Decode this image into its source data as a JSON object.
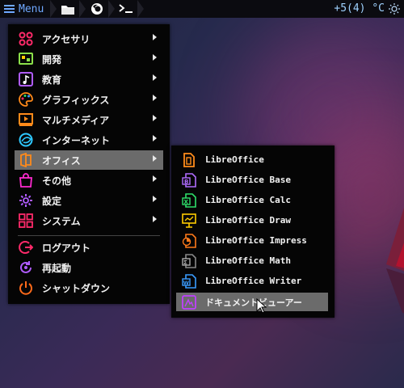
{
  "panel": {
    "menu_label": "Menu",
    "temperature": "+5(4) °C",
    "launchers": [
      "folder-icon",
      "firefox-icon",
      "terminal-icon"
    ]
  },
  "main_menu": {
    "items": [
      {
        "label": "アクセサリ",
        "icon": "accessories-icon",
        "submenu": true
      },
      {
        "label": "開発",
        "icon": "development-icon",
        "submenu": true
      },
      {
        "label": "教育",
        "icon": "education-icon",
        "submenu": true
      },
      {
        "label": "グラフィックス",
        "icon": "graphics-icon",
        "submenu": true
      },
      {
        "label": "マルチメディア",
        "icon": "multimedia-icon",
        "submenu": true
      },
      {
        "label": "インターネット",
        "icon": "internet-icon",
        "submenu": true
      },
      {
        "label": "オフィス",
        "icon": "office-icon",
        "submenu": true,
        "active": true
      },
      {
        "label": "その他",
        "icon": "other-icon",
        "submenu": true
      },
      {
        "label": "設定",
        "icon": "settings-icon",
        "submenu": true
      },
      {
        "label": "システム",
        "icon": "system-icon",
        "submenu": true
      }
    ],
    "session": [
      {
        "label": "ログアウト",
        "icon": "logout-icon"
      },
      {
        "label": "再起動",
        "icon": "reboot-icon"
      },
      {
        "label": "シャットダウン",
        "icon": "shutdown-icon"
      }
    ]
  },
  "office_submenu": {
    "items": [
      {
        "label": "LibreOffice",
        "icon": "libreoffice-icon",
        "color": "#ff8c1a"
      },
      {
        "label": "LibreOffice Base",
        "icon": "libreoffice-base-icon",
        "color": "#b06cff"
      },
      {
        "label": "LibreOffice Calc",
        "icon": "libreoffice-calc-icon",
        "color": "#2ee06a"
      },
      {
        "label": "LibreOffice Draw",
        "icon": "libreoffice-draw-icon",
        "color": "#ffcc00"
      },
      {
        "label": "LibreOffice Impress",
        "icon": "libreoffice-impress-icon",
        "color": "#ff7a1a"
      },
      {
        "label": "LibreOffice Math",
        "icon": "libreoffice-math-icon",
        "color": "#aaaaaa"
      },
      {
        "label": "LibreOffice Writer",
        "icon": "libreoffice-writer-icon",
        "color": "#3a9cff"
      },
      {
        "label": "ドキュメントビューアー",
        "icon": "document-viewer-icon",
        "color": "#c040ff",
        "active": true
      }
    ]
  },
  "colors": {
    "accent": "#6fa8ff",
    "highlight": "#6b6b6b",
    "menu_bg": "#050505"
  }
}
